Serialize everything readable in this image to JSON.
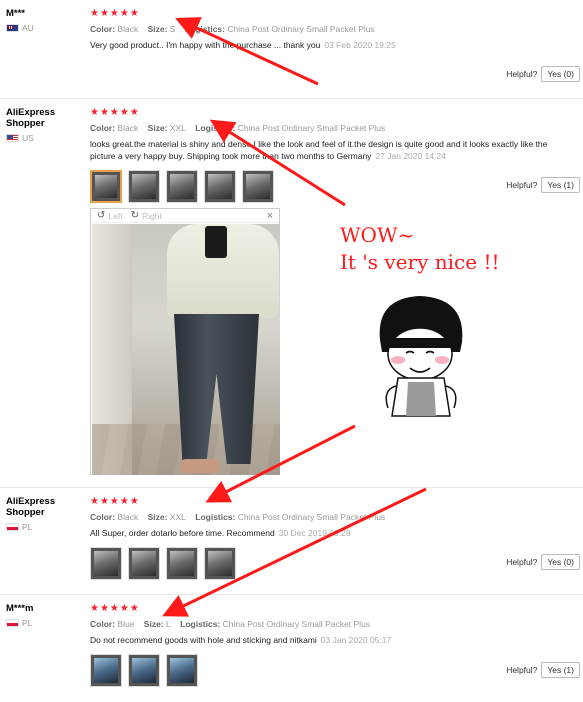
{
  "stars": "★★★★★",
  "labels": {
    "color": "Color:",
    "size": "Size:",
    "logistics": "Logistics:",
    "helpful": "Helpful?"
  },
  "viewer": {
    "left": "Left",
    "right": "Right",
    "close": "×"
  },
  "caption": {
    "line1": "WOW~",
    "line2": "It 's very nice !!"
  },
  "accent_colors": {
    "star": "#f5222d",
    "annotation_red": "#ff1a1a",
    "selected_thumb": "#e8a24a"
  },
  "reviews": [
    {
      "user": "M***",
      "country": "AU",
      "color": "Black",
      "size": "S",
      "logistics": "China Post Ordinary Small Packet Plus",
      "text": "Very good product.. I'm happy with the purchase ... thank you",
      "date": "03 Feb 2020 19:25",
      "helpful_button": "Yes (0)"
    },
    {
      "user": "AliExpress Shopper",
      "country": "US",
      "color": "Black",
      "size": "XXL",
      "logistics": "China Post Ordinary Small Packet Plus",
      "text": "looks great.the material is shiny and dense.I like the look and feel of it.the design is quite good and it looks exactly like the picture a very happy buy. Shipping took more than two months to Germany",
      "date": "27 Jan 2020 14:24",
      "helpful_button": "Yes (1)"
    },
    {
      "user": "AliExpress Shopper",
      "country": "PL",
      "color": "Black",
      "size": "XXL",
      "logistics": "China Post Ordinary Small Packet Plus",
      "text": "All Super, order dotarło before time. Recommend",
      "date": "30 Dec 2019 09:28",
      "helpful_button": "Yes (0)"
    },
    {
      "user": "M***m",
      "country": "PL",
      "color": "Blue",
      "size": "L",
      "logistics": "China Post Ordinary Small Packet Plus",
      "text": "Do not recommend goods with hole and sticking and nitkami",
      "date": "03 Jan 2020 05:17",
      "helpful_button": "Yes (1)"
    }
  ]
}
